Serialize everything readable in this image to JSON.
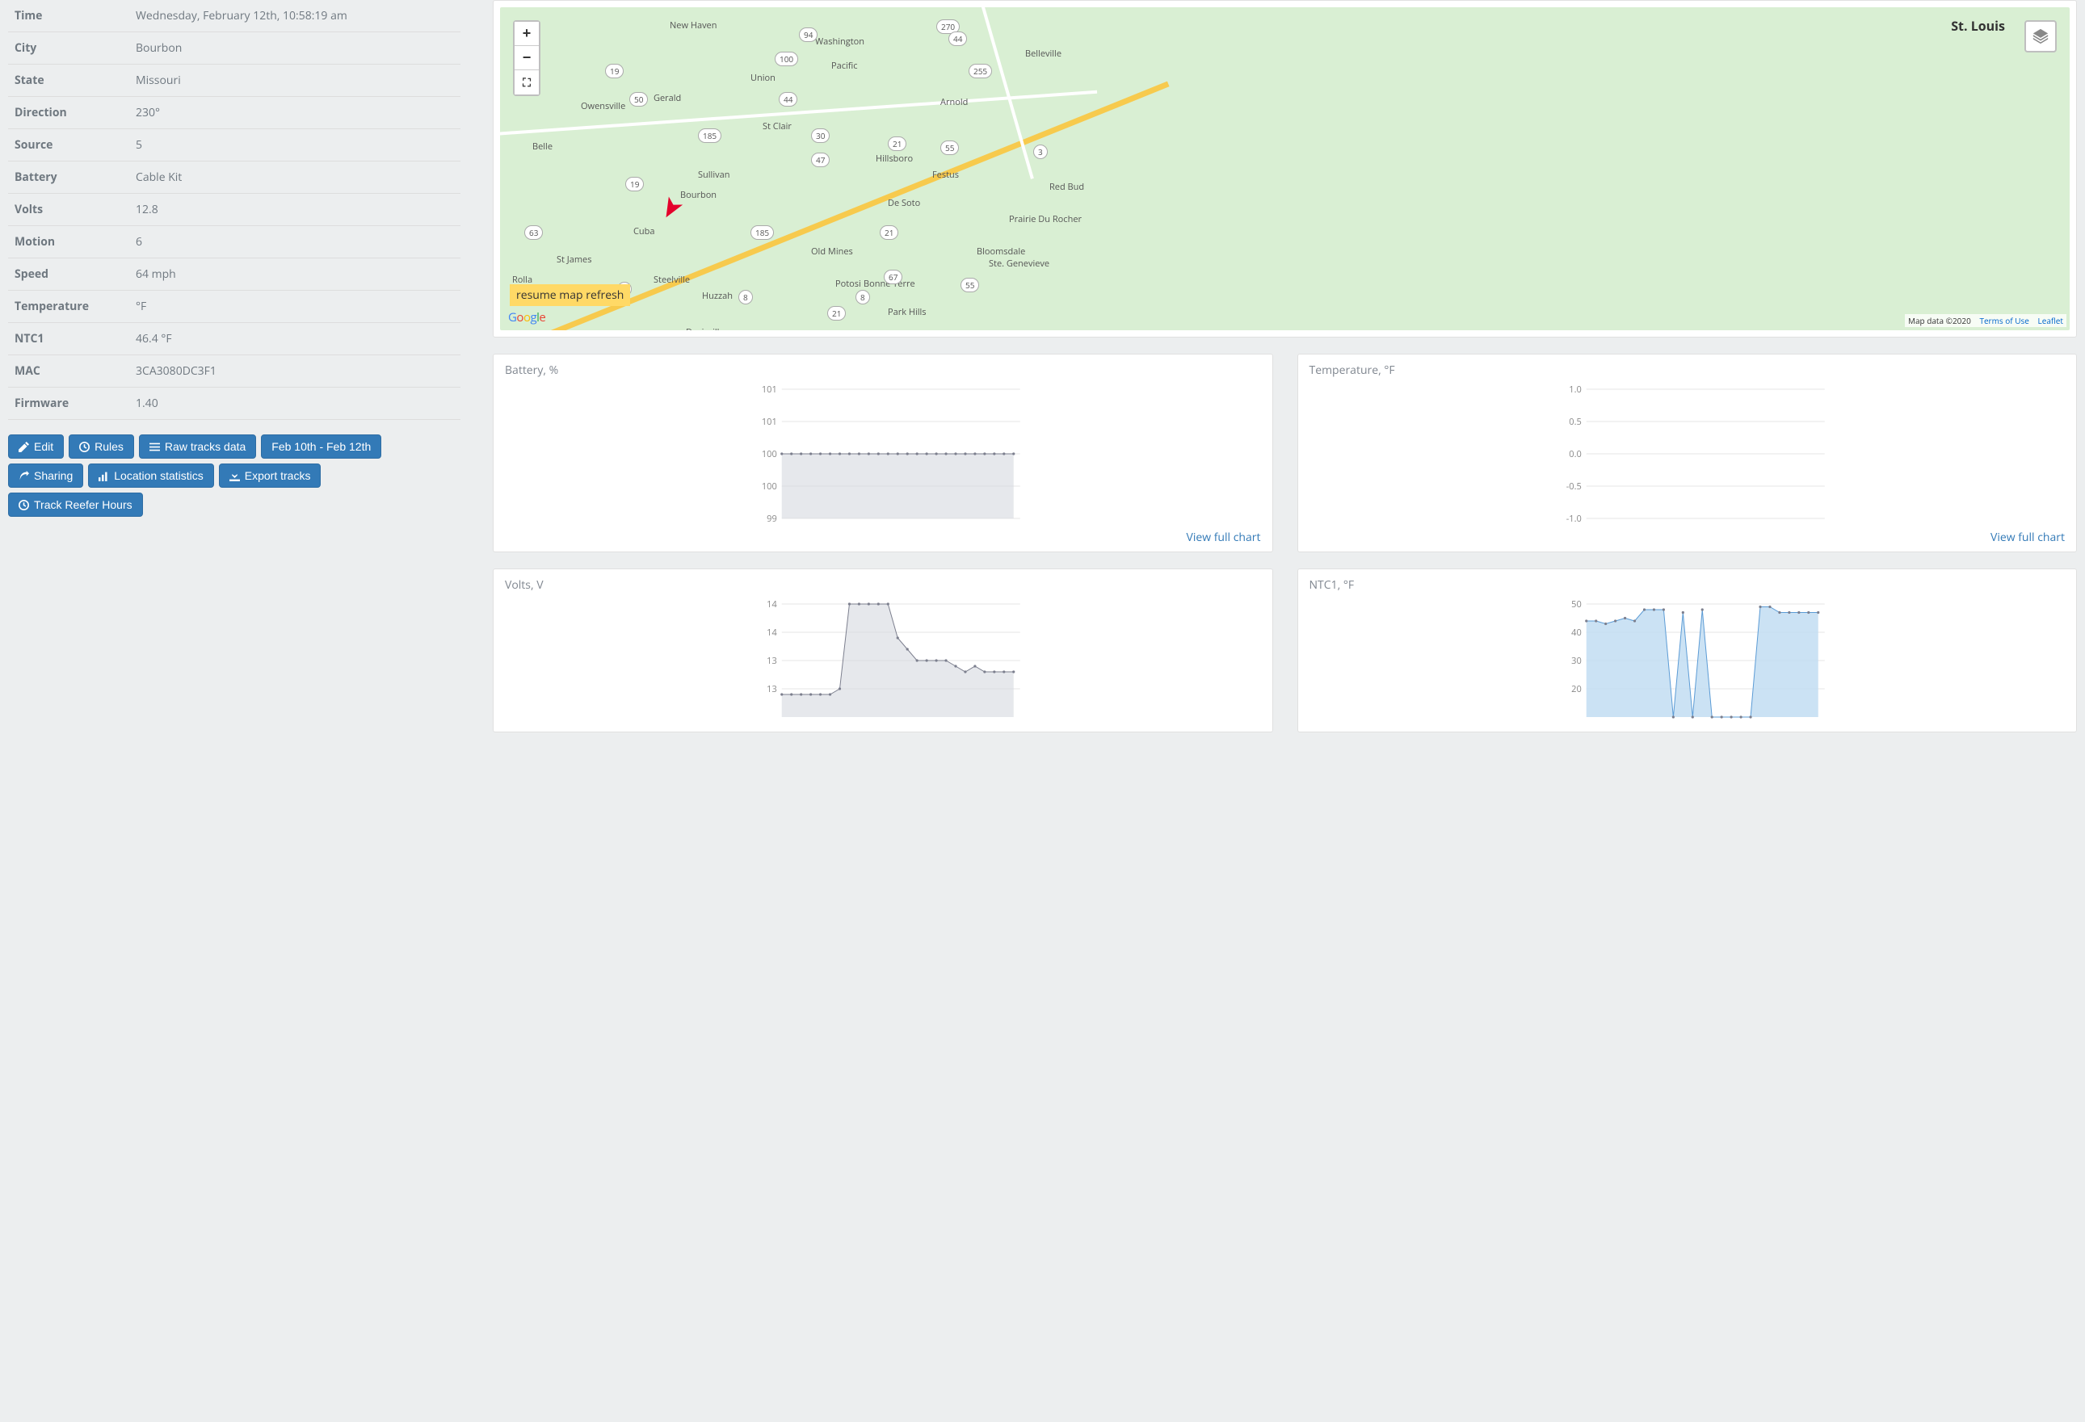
{
  "details": {
    "rows": [
      {
        "label": "Time",
        "value": "Wednesday, February 12th, 10:58:19 am"
      },
      {
        "label": "City",
        "value": "Bourbon"
      },
      {
        "label": "State",
        "value": "Missouri"
      },
      {
        "label": "Direction",
        "value": "230°"
      },
      {
        "label": "Source",
        "value": "5"
      },
      {
        "label": "Battery",
        "value": "Cable Kit"
      },
      {
        "label": "Volts",
        "value": "12.8"
      },
      {
        "label": "Motion",
        "value": "6"
      },
      {
        "label": "Speed",
        "value": "64 mph"
      },
      {
        "label": "Temperature",
        "value": "°F"
      },
      {
        "label": "NTC1",
        "value": "46.4 °F"
      },
      {
        "label": "MAC",
        "value": "3CA3080DC3F1"
      },
      {
        "label": "Firmware",
        "value": "1.40"
      }
    ]
  },
  "buttons": {
    "edit": "Edit",
    "rules": "Rules",
    "raw": "Raw tracks data",
    "date": "Feb 10th - Feb 12th",
    "sharing": "Sharing",
    "locstats": "Location statistics",
    "export": "Export tracks",
    "reefer": "Track Reefer Hours"
  },
  "map": {
    "st_louis": "St. Louis",
    "resume": "resume map refresh",
    "attr_data": "Map data ©2020",
    "attr_terms": "Terms of Use",
    "attr_leaflet": "Leaflet",
    "cities": [
      "New Haven",
      "Washington",
      "Union",
      "Gerald",
      "Owensville",
      "Belle",
      "St Clair",
      "Sullivan",
      "Bourbon",
      "Cuba",
      "Steelville",
      "St James",
      "Rolla",
      "Huzzah",
      "Davisville",
      "Potosi",
      "Old Mines",
      "Bonne Terre",
      "Park Hills",
      "Festus",
      "Hillsboro",
      "De Soto",
      "Arnold",
      "Pacific",
      "Belleville",
      "Prairie Du Rocher",
      "Bloomsdale",
      "Ste. Genevieve",
      "Red Bud"
    ],
    "routes": [
      "19",
      "50",
      "94",
      "100",
      "30",
      "185",
      "19",
      "63",
      "8",
      "8",
      "8",
      "185",
      "21",
      "21",
      "21",
      "47",
      "3",
      "55",
      "55",
      "270",
      "255",
      "67",
      "44",
      "44"
    ]
  },
  "charts": {
    "battery": {
      "title": "Battery, %",
      "link": "View full chart"
    },
    "temp": {
      "title": "Temperature, °F",
      "link": "View full chart"
    },
    "volts": {
      "title": "Volts, V"
    },
    "ntc1": {
      "title": "NTC1, °F"
    }
  },
  "chart_data": [
    {
      "type": "line",
      "title": "Battery, %",
      "ylabel": "%",
      "ylim": [
        99.0,
        101.0
      ],
      "yticks": [
        99.0,
        99.5,
        100.0,
        100.5,
        101.0
      ],
      "values": [
        100,
        100,
        100,
        100,
        100,
        100,
        100,
        100,
        100,
        100,
        100,
        100,
        100,
        100,
        100,
        100,
        100,
        100,
        100,
        100,
        100,
        100,
        100,
        100,
        100
      ]
    },
    {
      "type": "line",
      "title": "Temperature, °F",
      "ylabel": "°F",
      "ylim": [
        -1.0,
        1.0
      ],
      "yticks": [
        -1.0,
        -0.5,
        0,
        0.5,
        1.0
      ],
      "values": []
    },
    {
      "type": "line",
      "title": "Volts, V",
      "ylabel": "V",
      "ylim": [
        12.0,
        14.0
      ],
      "yticks": [
        12.5,
        13.0,
        13.5,
        14.0
      ],
      "values": [
        12.4,
        12.4,
        12.4,
        12.4,
        12.4,
        12.4,
        12.5,
        14.0,
        14.0,
        14.0,
        14.0,
        14.0,
        13.4,
        13.2,
        13.0,
        13.0,
        13.0,
        13.0,
        12.9,
        12.8,
        12.9,
        12.8,
        12.8,
        12.8,
        12.8
      ]
    },
    {
      "type": "area",
      "title": "NTC1, °F",
      "ylabel": "°F",
      "ylim": [
        10,
        50
      ],
      "yticks": [
        20,
        30,
        40,
        50
      ],
      "values": [
        44,
        44,
        43,
        44,
        45,
        44,
        48,
        48,
        48,
        10,
        47,
        10,
        48,
        10,
        10,
        10,
        10,
        10,
        49,
        49,
        47,
        47,
        47,
        47,
        47
      ]
    }
  ]
}
